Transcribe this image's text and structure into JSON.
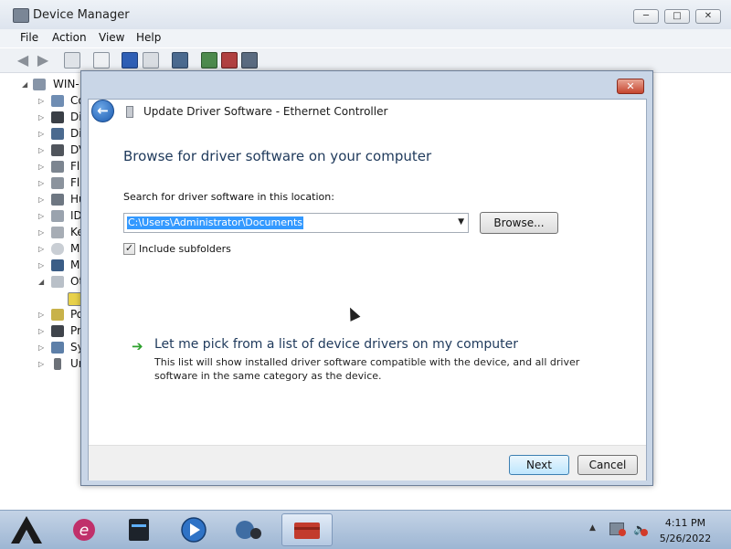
{
  "window": {
    "title": "Device Manager",
    "minimize_glyph": "─",
    "maximize_glyph": "□",
    "close_glyph": "✕"
  },
  "menu": [
    "File",
    "Action",
    "View",
    "Help"
  ],
  "tree": {
    "root": "WIN-",
    "items": [
      {
        "label": "Co",
        "icon": "computer-icon"
      },
      {
        "label": "Di",
        "icon": "disk-drive-icon"
      },
      {
        "label": "Di",
        "icon": "display-adapter-icon"
      },
      {
        "label": "DV",
        "icon": "dvd-drive-icon"
      },
      {
        "label": "Fl",
        "icon": "floppy-controller-icon"
      },
      {
        "label": "Fl",
        "icon": "floppy-drive-icon"
      },
      {
        "label": "Hu",
        "icon": "hid-icon"
      },
      {
        "label": "ID",
        "icon": "ide-controller-icon"
      },
      {
        "label": "Ke",
        "icon": "keyboard-icon"
      },
      {
        "label": "Mi",
        "icon": "mouse-icon"
      },
      {
        "label": "Mo",
        "icon": "monitor-icon"
      },
      {
        "label": "Ot",
        "icon": "other-devices-icon"
      },
      {
        "label": "",
        "icon": "warning-device-icon"
      },
      {
        "label": "Po",
        "icon": "ports-icon"
      },
      {
        "label": "Pr",
        "icon": "processor-icon"
      },
      {
        "label": "Sy",
        "icon": "system-devices-icon"
      },
      {
        "label": "Ur",
        "icon": "usb-controller-icon"
      }
    ]
  },
  "dialog": {
    "caption": "Update Driver Software - Ethernet Controller",
    "heading": "Browse for driver software on your computer",
    "search_label": "Search for driver software in this location:",
    "path_value": "C:\\Users\\Administrator\\Documents",
    "browse_label": "Browse...",
    "include_subfolders_label": "Include subfolders",
    "include_subfolders_checked": true,
    "pick_title": "Let me pick from a list of device drivers on my computer",
    "pick_description": "This list will show installed driver software compatible with the device, and all driver software in the same category as the device.",
    "next_label": "Next",
    "cancel_label": "Cancel",
    "close_glyph": "✕"
  },
  "taskbar": {
    "time": "4:11 PM",
    "date": "5/26/2022"
  },
  "colors": {
    "heading": "#1e395b",
    "selection": "#3399ff",
    "close_red": "#c5452f",
    "taskbar": "#b1c6df"
  }
}
